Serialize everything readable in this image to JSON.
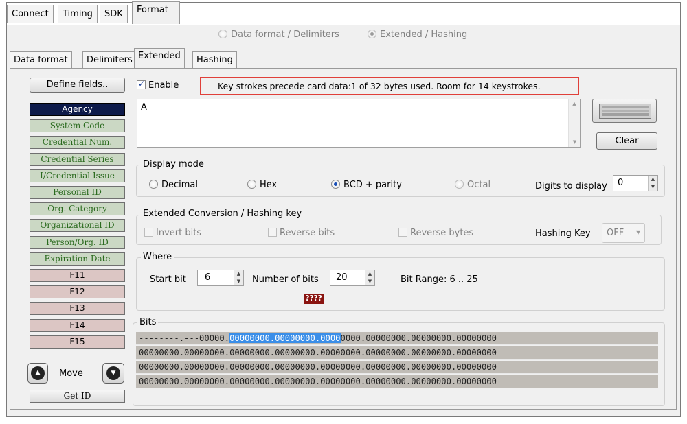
{
  "top_tabs": [
    "Connect",
    "Timing",
    "SDK",
    "Format"
  ],
  "format_mode": {
    "options": [
      "Data format / Delimiters",
      "Extended / Hashing"
    ],
    "selected": "Extended / Hashing"
  },
  "inner_tabs": [
    "Data format",
    "Delimiters",
    "Extended",
    "Hashing"
  ],
  "define_fields_label": "Define fields..",
  "fields": [
    {
      "label": "Agency",
      "state": "selected"
    },
    {
      "label": "System Code",
      "state": "green"
    },
    {
      "label": "Credential Num.",
      "state": "green"
    },
    {
      "label": "Credential Series",
      "state": "green"
    },
    {
      "label": "I/Credential Issue",
      "state": "green"
    },
    {
      "label": "Personal ID",
      "state": "green"
    },
    {
      "label": "Org. Category",
      "state": "green"
    },
    {
      "label": "Organizational ID",
      "state": "green"
    },
    {
      "label": "Person/Org. ID",
      "state": "green"
    },
    {
      "label": "Expiration Date",
      "state": "green"
    },
    {
      "label": "F11",
      "state": "pink"
    },
    {
      "label": "F12",
      "state": "pink"
    },
    {
      "label": "F13",
      "state": "pink"
    },
    {
      "label": "F14",
      "state": "pink"
    },
    {
      "label": "F15",
      "state": "pink"
    }
  ],
  "move_label": "Move",
  "get_id_label": "Get ID",
  "enable_label": "Enable",
  "keystroke_status": "Key strokes precede card data:1 of 32 bytes used. Room for 14 keystrokes.",
  "keystroke_text": "A",
  "clear_label": "Clear",
  "display_mode": {
    "title": "Display mode",
    "options": [
      "Decimal",
      "Hex",
      "BCD + parity",
      "Octal"
    ],
    "selected": "BCD + parity",
    "digits_label": "Digits to display",
    "digits_value": "0"
  },
  "conversion": {
    "title": "Extended Conversion / Hashing key",
    "invert": "Invert  bits",
    "reverse_bits": "Reverse bits",
    "reverse_bytes": "Reverse bytes",
    "hashing_label": "Hashing Key",
    "hashing_value": "OFF"
  },
  "where": {
    "title": "Where",
    "start_label": "Start bit",
    "start_value": "6",
    "num_label": "Number of bits",
    "num_value": "20",
    "range_label": "Bit Range: 6 .. 25",
    "unknown_badge": "????"
  },
  "bits": {
    "title": "Bits",
    "row1_pre": "--------.---00000.",
    "row1_hl": "00000000.00000000.0000",
    "row1_post": "0000.00000000.00000000.00000000",
    "rows": [
      "00000000.00000000.00000000.00000000.00000000.00000000.00000000.00000000",
      "00000000.00000000.00000000.00000000.00000000.00000000.00000000.00000000",
      "00000000.00000000.00000000.00000000.00000000.00000000.00000000.00000000"
    ]
  }
}
